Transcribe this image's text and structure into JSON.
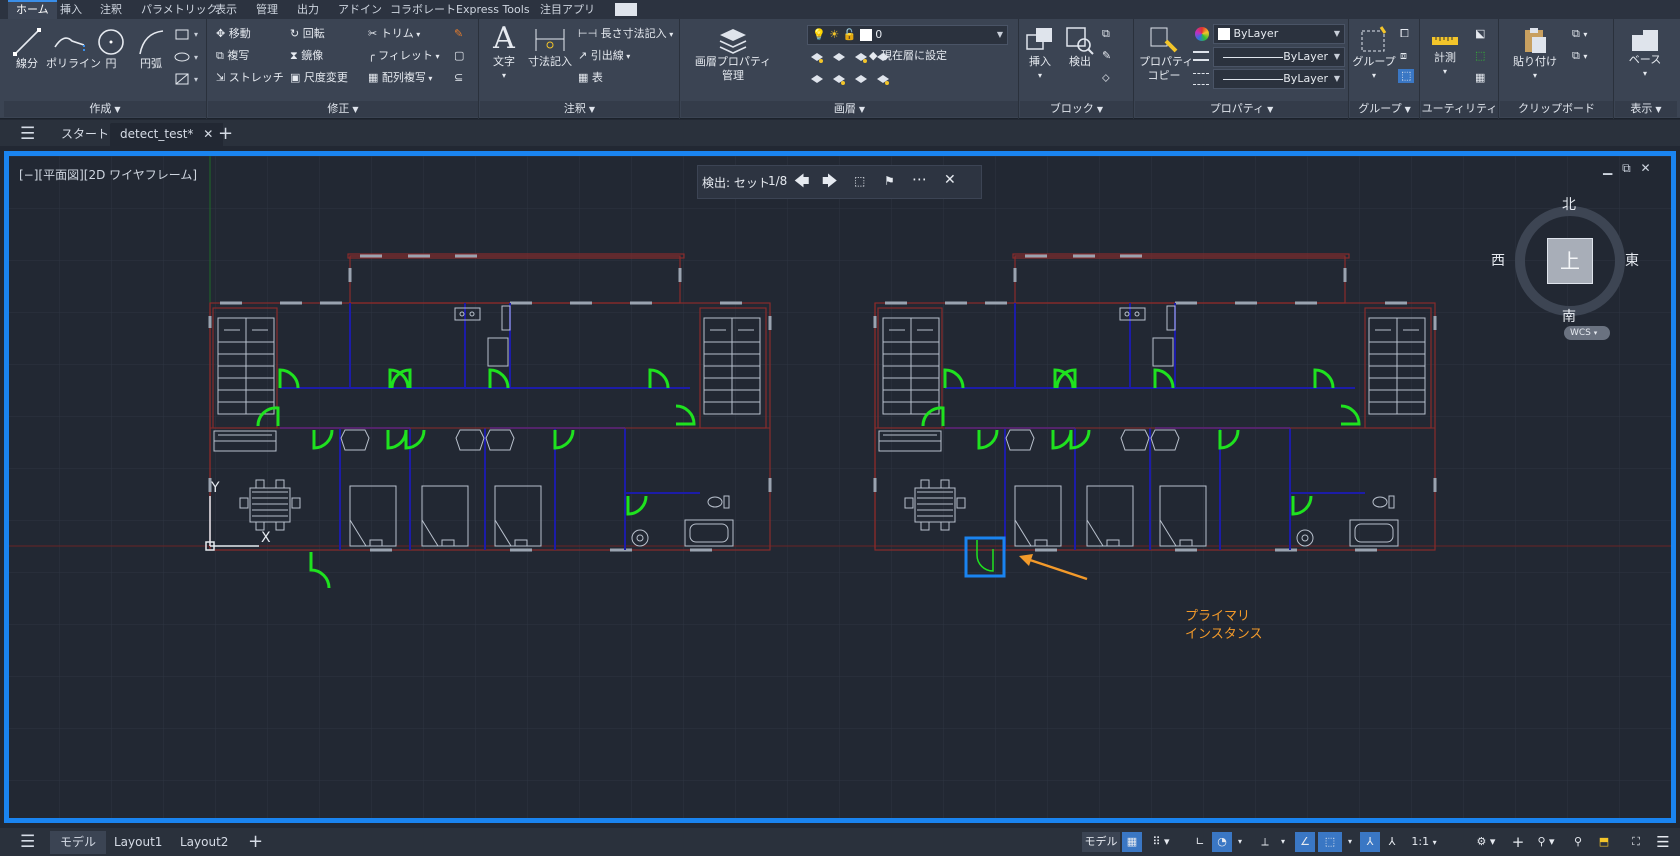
{
  "colors": {
    "accent": "#1a84f0",
    "door": "#1fe21f",
    "wall": "#8a2b2b",
    "partition": "#1c1ca8",
    "annotation": "#f39a2a",
    "background": "#222833"
  },
  "ribbon_tabs": [
    "ホーム",
    "挿入",
    "注釈",
    "パラメトリック",
    "表示",
    "管理",
    "出力",
    "アドイン",
    "コラボレート",
    "Express Tools",
    "注目アプリ"
  ],
  "panels": {
    "create": {
      "title": "作成",
      "line": "線分",
      "polyline": "ポリライン",
      "circle": "円",
      "arc": "円弧"
    },
    "modify": {
      "title": "修正",
      "move": "移動",
      "rotate": "回転",
      "trim": "トリム",
      "copy": "複写",
      "mirror": "鏡像",
      "fillet": "フィレット",
      "stretch": "ストレッチ",
      "scale": "尺度変更",
      "array": "配列複写"
    },
    "annotation": {
      "title": "注釈",
      "text": "文字",
      "dimension": "寸法記入",
      "linear": "長さ寸法記入",
      "leader": "引出線",
      "table": "表"
    },
    "layers": {
      "title": "画層",
      "properties": "画層プロパティ",
      "manage": "管理",
      "layer_value": "0",
      "set_current": "現在層に設定"
    },
    "block": {
      "title": "ブロック",
      "insert": "挿入",
      "detect": "検出"
    },
    "properties": {
      "title": "プロパティ",
      "match1": "プロパティ",
      "match2": "コピー",
      "color": "ByLayer",
      "linetype": "ByLayer",
      "lineweight": "ByLayer"
    },
    "groups": {
      "title": "グループ",
      "group": "グループ"
    },
    "utilities": {
      "title": "ユーティリティ",
      "measure": "計測"
    },
    "clipboard": {
      "title": "クリップボード",
      "paste": "貼り付け"
    },
    "view": {
      "title": "表示",
      "base": "ベース"
    }
  },
  "file_tabs": {
    "start": "スタート",
    "current": "detect_test*"
  },
  "viewport": {
    "label": "[−][平面図][2D ワイヤフレーム]",
    "nav": {
      "title": "検出: セット",
      "counter": "1/8"
    },
    "compass": {
      "north": "北",
      "south": "南",
      "east": "東",
      "west": "西",
      "top": "上",
      "wcs": "WCS"
    },
    "ucs_x": "X",
    "ucs_y": "Y",
    "annotation_line1": "プライマリ",
    "annotation_line2": "インスタンス"
  },
  "layout_tabs": [
    "モデル",
    "Layout1",
    "Layout2"
  ],
  "status": {
    "model": "モデル",
    "scale": "1:1"
  }
}
